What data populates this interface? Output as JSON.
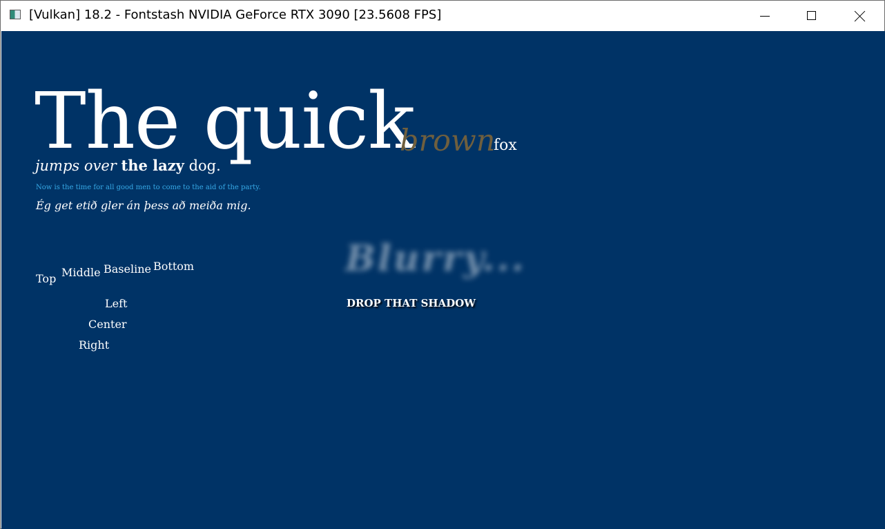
{
  "window": {
    "title": "[Vulkan] 18.2 - Fontstash NVIDIA GeForce RTX 3090 [23.5608 FPS]",
    "background_color": "#003366"
  },
  "demo": {
    "big_text": "The quick",
    "brown_text": "brown",
    "brown_color": "#6f5f3e",
    "fox_text": "fox",
    "jumps": {
      "italic": "jumps over",
      "bold": "the lazy",
      "regular": "dog."
    },
    "now_text": "Now is the time for all good men to come to the aid of the party.",
    "now_color": "#36a9e6",
    "icelandic_text": "Ég get etið gler án þess að meiða mig.",
    "vertical_align": {
      "top": "Top",
      "middle": "Middle",
      "baseline": "Baseline",
      "bottom": "Bottom"
    },
    "horizontal_align": {
      "left": "Left",
      "center": "Center",
      "right": "Right"
    },
    "blurry_text": "Blurry...",
    "shadow_text": "DROP THAT SHADOW"
  }
}
